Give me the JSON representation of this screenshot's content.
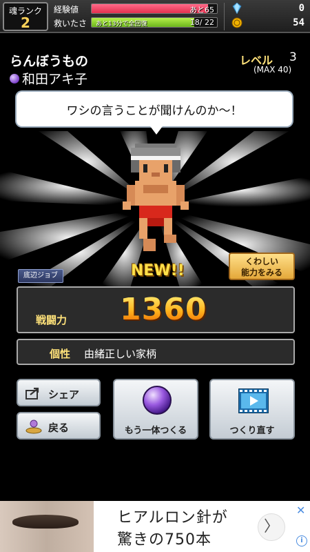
{
  "status": {
    "rank_label": "魂ランク",
    "rank_value": "2",
    "exp_label": "経験値",
    "exp_remaining": "あと65",
    "exp_progress": 0.93,
    "help_label": "救いたさ",
    "help_value": "18/ 22",
    "help_recovery": "あと13分で全回復",
    "help_progress": 0.82,
    "gems": "0",
    "coins": "54"
  },
  "character": {
    "name": "らんぼうもの",
    "owner": "和田アキ子",
    "level_label": "レベル",
    "level": "3",
    "level_max": "(MAX 40)",
    "speech": "ワシの言うことが聞けんのか～！",
    "new_badge": "NEW!!",
    "job_tag": "底辺ジョブ",
    "detail_button": "くわしい\n能力をみる"
  },
  "stats": {
    "power_label": "戦闘力",
    "power_value": "1360",
    "trait_label": "個性",
    "trait_value": "由緒正しい家柄"
  },
  "buttons": {
    "share": "シェア",
    "back": "戻る",
    "make_another": "もう一体つくる",
    "remake": "つくり直す"
  },
  "ad": {
    "line1": "ヒアルロン針が",
    "line2": "驚きの750本",
    "arrow": "〉",
    "close": "✕",
    "info": "i"
  },
  "colors": {
    "exp_bar": "#e2304e",
    "help_bar": "#6cb51c",
    "accent_gold": "#ffe27a",
    "power_orange": "#ffb21c"
  }
}
